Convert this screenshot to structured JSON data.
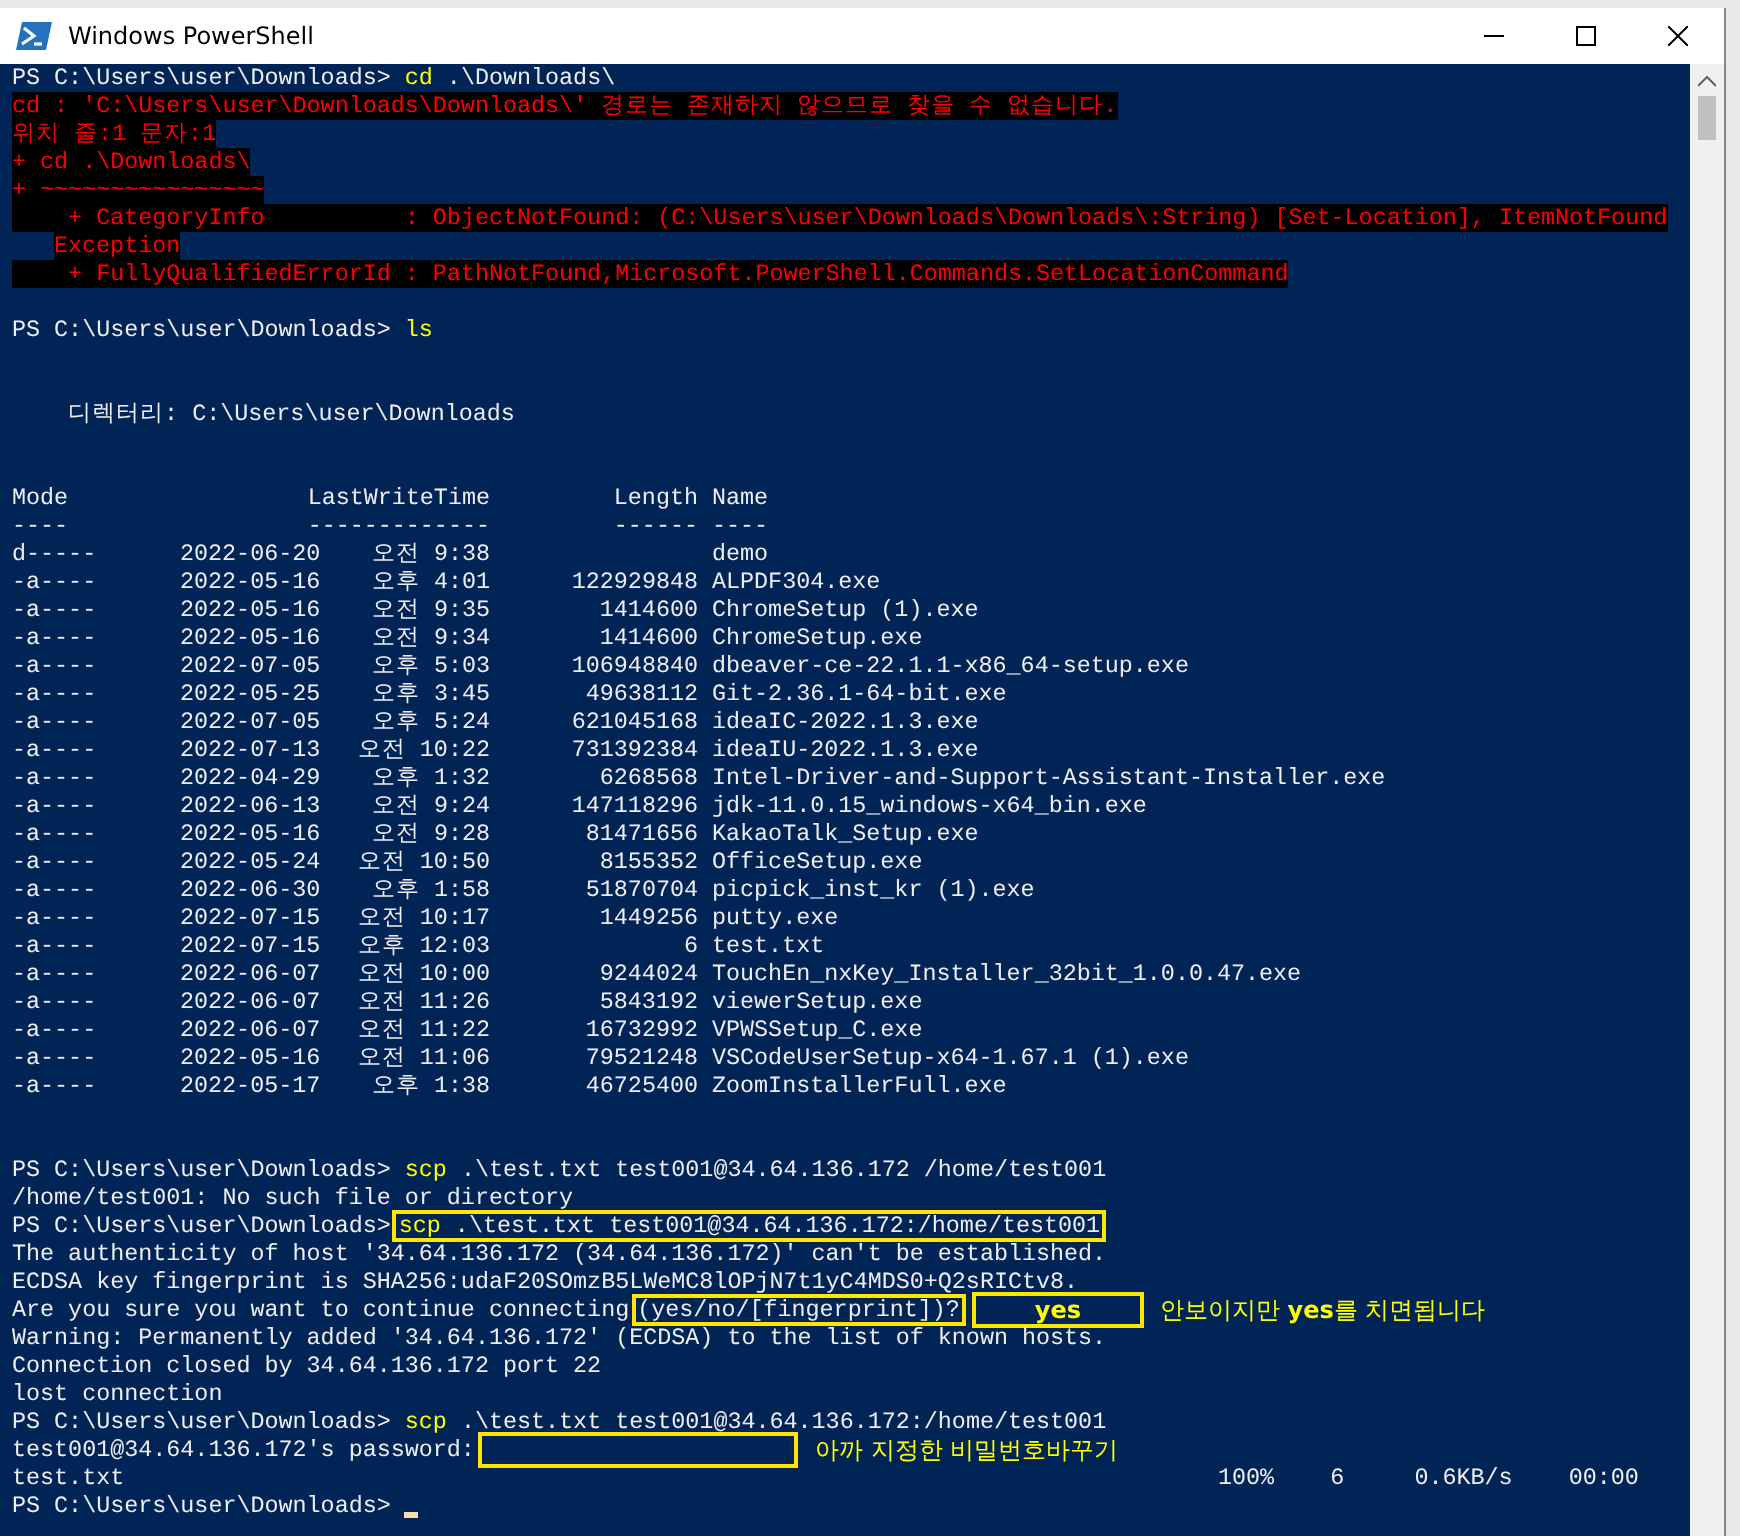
{
  "window": {
    "title": "Windows PowerShell"
  },
  "console": {
    "lines": [
      {
        "kind": "text",
        "segments": [
          {
            "kind": "plain",
            "text": "PS C:\\Users\\user\\Downloads> "
          },
          {
            "kind": "keyword",
            "text": "cd"
          },
          {
            "kind": "plain",
            "text": " .\\Downloads\\"
          }
        ]
      },
      {
        "kind": "text",
        "segments": [
          {
            "kind": "error",
            "text": "cd : 'C:\\Users\\user\\Downloads\\Downloads\\' 경로는 존재하지 않으므로 찾을 수 없습니다."
          }
        ]
      },
      {
        "kind": "text",
        "segments": [
          {
            "kind": "error",
            "text": "위치 줄:1 문자:1"
          }
        ]
      },
      {
        "kind": "text",
        "segments": [
          {
            "kind": "error",
            "text": "+ cd .\\Downloads\\"
          }
        ]
      },
      {
        "kind": "text",
        "segments": [
          {
            "kind": "error",
            "text": "+ ~~~~~~~~~~~~~~~~"
          }
        ]
      },
      {
        "kind": "text",
        "segments": [
          {
            "kind": "error",
            "text": "    + CategoryInfo          : ObjectNotFound: (C:\\Users\\user\\Downloads\\Downloads\\:String) [Set-Location], ItemNotFound"
          }
        ]
      },
      {
        "kind": "text",
        "segments": [
          {
            "kind": "error-indented",
            "text": "Exception"
          }
        ]
      },
      {
        "kind": "text",
        "segments": [
          {
            "kind": "error",
            "text": "    + FullyQualifiedErrorId : PathNotFound,Microsoft.PowerShell.Commands.SetLocationCommand"
          }
        ]
      },
      {
        "kind": "blank"
      },
      {
        "kind": "text",
        "segments": [
          {
            "kind": "plain",
            "text": "PS C:\\Users\\user\\Downloads> "
          },
          {
            "kind": "keyword",
            "text": "ls"
          }
        ]
      },
      {
        "kind": "blank"
      },
      {
        "kind": "blank"
      },
      {
        "kind": "text",
        "segments": [
          {
            "kind": "plain",
            "text": "    디렉터리: C:\\Users\\user\\Downloads"
          }
        ]
      },
      {
        "kind": "blank"
      },
      {
        "kind": "blank"
      },
      {
        "kind": "header",
        "cells": [
          "Mode",
          "LastWriteTime",
          "Length",
          "Name"
        ]
      },
      {
        "kind": "header",
        "cells": [
          "----",
          "-------------",
          "------",
          "----"
        ]
      },
      {
        "kind": "file",
        "mode": "d-----",
        "date": "2022-06-20",
        "ampm": "오전",
        "time": "9:38",
        "name": "demo"
      },
      {
        "kind": "file",
        "mode": "-a----",
        "date": "2022-05-16",
        "ampm": "오후",
        "time": "4:01",
        "length": "122929848",
        "name": "ALPDF304.exe"
      },
      {
        "kind": "file",
        "mode": "-a----",
        "date": "2022-05-16",
        "ampm": "오전",
        "time": "9:35",
        "length": "1414600",
        "name": "ChromeSetup (1).exe"
      },
      {
        "kind": "file",
        "mode": "-a----",
        "date": "2022-05-16",
        "ampm": "오전",
        "time": "9:34",
        "length": "1414600",
        "name": "ChromeSetup.exe"
      },
      {
        "kind": "file",
        "mode": "-a----",
        "date": "2022-07-05",
        "ampm": "오후",
        "time": "5:03",
        "length": "106948840",
        "name": "dbeaver-ce-22.1.1-x86_64-setup.exe"
      },
      {
        "kind": "file",
        "mode": "-a----",
        "date": "2022-05-25",
        "ampm": "오후",
        "time": "3:45",
        "length": "49638112",
        "name": "Git-2.36.1-64-bit.exe"
      },
      {
        "kind": "file",
        "mode": "-a----",
        "date": "2022-07-05",
        "ampm": "오후",
        "time": "5:24",
        "length": "621045168",
        "name": "ideaIC-2022.1.3.exe"
      },
      {
        "kind": "file",
        "mode": "-a----",
        "date": "2022-07-13",
        "ampm": "오전",
        "time": "10:22",
        "length": "731392384",
        "name": "ideaIU-2022.1.3.exe"
      },
      {
        "kind": "file",
        "mode": "-a----",
        "date": "2022-04-29",
        "ampm": "오후",
        "time": "1:32",
        "length": "6268568",
        "name": "Intel-Driver-and-Support-Assistant-Installer.exe"
      },
      {
        "kind": "file",
        "mode": "-a----",
        "date": "2022-06-13",
        "ampm": "오전",
        "time": "9:24",
        "length": "147118296",
        "name": "jdk-11.0.15_windows-x64_bin.exe"
      },
      {
        "kind": "file",
        "mode": "-a----",
        "date": "2022-05-16",
        "ampm": "오전",
        "time": "9:28",
        "length": "81471656",
        "name": "KakaoTalk_Setup.exe"
      },
      {
        "kind": "file",
        "mode": "-a----",
        "date": "2022-05-24",
        "ampm": "오전",
        "time": "10:50",
        "length": "8155352",
        "name": "OfficeSetup.exe"
      },
      {
        "kind": "file",
        "mode": "-a----",
        "date": "2022-06-30",
        "ampm": "오후",
        "time": "1:58",
        "length": "51870704",
        "name": "picpick_inst_kr (1).exe"
      },
      {
        "kind": "file",
        "mode": "-a----",
        "date": "2022-07-15",
        "ampm": "오전",
        "time": "10:17",
        "length": "1449256",
        "name": "putty.exe"
      },
      {
        "kind": "file",
        "mode": "-a----",
        "date": "2022-07-15",
        "ampm": "오후",
        "time": "12:03",
        "length": "6",
        "name": "test.txt"
      },
      {
        "kind": "file",
        "mode": "-a----",
        "date": "2022-06-07",
        "ampm": "오전",
        "time": "10:00",
        "length": "9244024",
        "name": "TouchEn_nxKey_Installer_32bit_1.0.0.47.exe"
      },
      {
        "kind": "file",
        "mode": "-a----",
        "date": "2022-06-07",
        "ampm": "오전",
        "time": "11:26",
        "length": "5843192",
        "name": "viewerSetup.exe"
      },
      {
        "kind": "file",
        "mode": "-a----",
        "date": "2022-06-07",
        "ampm": "오전",
        "time": "11:22",
        "length": "16732992",
        "name": "VPWSSetup_C.exe"
      },
      {
        "kind": "file",
        "mode": "-a----",
        "date": "2022-05-16",
        "ampm": "오전",
        "time": "11:06",
        "length": "79521248",
        "name": "VSCodeUserSetup-x64-1.67.1 (1).exe"
      },
      {
        "kind": "file",
        "mode": "-a----",
        "date": "2022-05-17",
        "ampm": "오후",
        "time": "1:38",
        "length": "46725400",
        "name": "ZoomInstallerFull.exe"
      },
      {
        "kind": "blank"
      },
      {
        "kind": "blank"
      },
      {
        "kind": "text",
        "segments": [
          {
            "kind": "plain",
            "text": "PS C:\\Users\\user\\Downloads> "
          },
          {
            "kind": "keyword",
            "text": "scp"
          },
          {
            "kind": "plain",
            "text": " .\\test.txt test001@34.64.136.172 /home/test001"
          }
        ]
      },
      {
        "kind": "text",
        "segments": [
          {
            "kind": "plain",
            "text": "/home/test001: No such file or directory"
          }
        ]
      },
      {
        "kind": "text",
        "segments": [
          {
            "kind": "plain",
            "text": "PS C:\\Users\\user\\Downloads>"
          },
          {
            "kind": "boxed",
            "segments": [
              {
                "kind": "keyword",
                "text": "scp"
              },
              {
                "kind": "plain",
                "text": " .\\test.txt test001@34.64.136.172:/home/test001"
              }
            ]
          }
        ]
      },
      {
        "kind": "text",
        "segments": [
          {
            "kind": "plain",
            "text": "The authenticity of host '34.64.136.172 (34.64.136.172)' can't be established."
          }
        ]
      },
      {
        "kind": "text",
        "segments": [
          {
            "kind": "plain",
            "text": "ECDSA key fingerprint is SHA256:udaF20SOmzB5LWeMC8lOPjN7t1yC4MDS0+Q2sRICtv8."
          }
        ]
      },
      {
        "kind": "text",
        "segments": [
          {
            "kind": "plain",
            "text": "Are you sure you want to continue connecting"
          },
          {
            "kind": "boxed",
            "segments": [
              {
                "kind": "plain",
                "text": "(yes/no/[fingerprint])?"
              }
            ]
          },
          {
            "kind": "answer",
            "text": "yes"
          },
          {
            "kind": "note",
            "text": "안보이지만 **yes**를 치면됩니다"
          }
        ]
      },
      {
        "kind": "text",
        "segments": [
          {
            "kind": "plain",
            "text": "Warning: Permanently added '34.64.136.172' (ECDSA) to the list of known hosts."
          }
        ]
      },
      {
        "kind": "text",
        "segments": [
          {
            "kind": "plain",
            "text": "Connection closed by 34.64.136.172 port 22"
          }
        ]
      },
      {
        "kind": "text",
        "segments": [
          {
            "kind": "plain",
            "text": "lost connection"
          }
        ]
      },
      {
        "kind": "text",
        "segments": [
          {
            "kind": "plain",
            "text": "PS C:\\Users\\user\\Downloads> "
          },
          {
            "kind": "keyword",
            "text": "scp"
          },
          {
            "kind": "plain",
            "text": " .\\test.txt test001@34.64.136.172:/home/test001"
          }
        ]
      },
      {
        "kind": "text",
        "segments": [
          {
            "kind": "plain",
            "text": "test001@34.64.136.172's password:"
          },
          {
            "kind": "input"
          },
          {
            "kind": "note",
            "text": "아까 지정한 비밀번호바꾸기"
          }
        ]
      },
      {
        "kind": "progress",
        "file": "test.txt",
        "stats": "100%    6     0.6KB/s    00:00"
      },
      {
        "kind": "text",
        "cursor": true,
        "segments": [
          {
            "kind": "plain",
            "text": "PS C:\\Users\\user\\Downloads> "
          }
        ]
      }
    ]
  }
}
